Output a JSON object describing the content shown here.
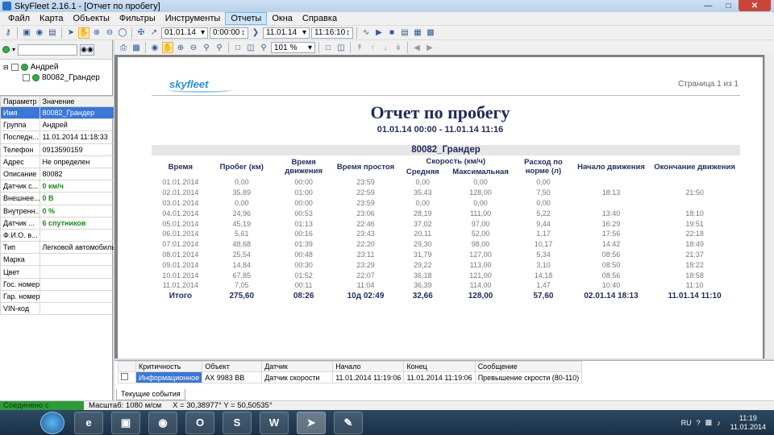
{
  "window": {
    "title": "SkyFleet 2.16.1 - [Отчет по пробегу]"
  },
  "menu": [
    "Файл",
    "Карта",
    "Объекты",
    "Фильтры",
    "Инструменты",
    "Отчеты",
    "Окна",
    "Справка"
  ],
  "toolbar": {
    "date_from": "01.01.14",
    "time_from": "0:00:00",
    "date_to": "11.01.14",
    "time_to": "11:16:10"
  },
  "tree": {
    "group": "Андрей",
    "vehicle": "80082_Грандер"
  },
  "props": {
    "headers": [
      "Параметр",
      "Значение"
    ],
    "rows": [
      [
        "Имя",
        "80082_Грандер"
      ],
      [
        "Группа",
        "Андрей"
      ],
      [
        "Последн...",
        "11.01.2014 11:18:33"
      ],
      [
        "Телефон",
        "0913590159"
      ],
      [
        "Адрес",
        "Не определен"
      ],
      [
        "Описание",
        "80082"
      ],
      [
        "Датчик с...",
        "0  км/ч"
      ],
      [
        "Внешнее...",
        "0  В"
      ],
      [
        "Внутренн...",
        "0  %"
      ],
      [
        "Датчик ...",
        "6 спутников"
      ],
      [
        "Ф.И.О. в...",
        ""
      ],
      [
        "Тип",
        "Легковой автомобиль"
      ],
      [
        "Марка",
        ""
      ],
      [
        "Цвет",
        ""
      ],
      [
        "Гос. номер",
        ""
      ],
      [
        "Гар. номер",
        ""
      ],
      [
        "VIN-код",
        ""
      ]
    ]
  },
  "viewer": {
    "zoom": "101 %"
  },
  "report": {
    "logo": "skyfleet",
    "page_info": "Страница 1 из 1",
    "title": "Отчет по пробегу",
    "period": "01.01.14 00:00 - 11.01.14 11:16",
    "vehicle": "80082_Грандер",
    "headers": {
      "time": "Время",
      "mileage": "Пробег (км)",
      "moving": "Время движения",
      "idle": "Время простоя",
      "speed": "Скорость (км/ч)",
      "avg": "Средняя",
      "max": "Максимальная",
      "fuel": "Расход по норме (л)",
      "start": "Начало движения",
      "end": "Окончание движения"
    },
    "rows": [
      [
        "01.01.2014",
        "0,00",
        "00:00",
        "23:59",
        "0,00",
        "0,00",
        "0,00",
        "",
        ""
      ],
      [
        "02.01.2014",
        "35,89",
        "01:00",
        "22:59",
        "35,43",
        "128,00",
        "7,50",
        "18:13",
        "21:50"
      ],
      [
        "03.01.2014",
        "0,00",
        "00:00",
        "23:59",
        "0,00",
        "0,00",
        "0,00",
        "",
        ""
      ],
      [
        "04.01.2014",
        "24,96",
        "00:53",
        "23:06",
        "28,19",
        "111,00",
        "5,22",
        "13:40",
        "18:10"
      ],
      [
        "05.01.2014",
        "45,19",
        "01:13",
        "22:46",
        "37,02",
        "97,00",
        "9,44",
        "16:29",
        "19:51"
      ],
      [
        "06.01.2014",
        "5,61",
        "00:16",
        "23:43",
        "20,11",
        "52,00",
        "1,17",
        "17:56",
        "22:18"
      ],
      [
        "07.01.2014",
        "48,68",
        "01:39",
        "22:20",
        "29,30",
        "98,00",
        "10,17",
        "14:42",
        "18:49"
      ],
      [
        "08.01.2014",
        "25,54",
        "00:48",
        "23:11",
        "31,79",
        "127,00",
        "5,34",
        "08:56",
        "21:37"
      ],
      [
        "09.01.2014",
        "14,84",
        "00:30",
        "23:29",
        "29,22",
        "113,00",
        "3,10",
        "08:50",
        "18:22"
      ],
      [
        "10.01.2014",
        "67,85",
        "01:52",
        "22:07",
        "36,18",
        "121,00",
        "14,18",
        "08:56",
        "18:58"
      ],
      [
        "11.01.2014",
        "7,05",
        "00:11",
        "11:04",
        "36,39",
        "114,00",
        "1,47",
        "10:40",
        "11:10"
      ]
    ],
    "total": [
      "Итого",
      "275,60",
      "08:26",
      "10д 02:49",
      "32,66",
      "128,00",
      "57,60",
      "02.01.14 18:13",
      "11.01.14 11:10"
    ]
  },
  "events": {
    "headers": [
      "",
      "Критичность",
      "Объект",
      "Датчик",
      "Начало",
      "Конец",
      "Сообщение"
    ],
    "rows": [
      [
        "",
        "Информационное",
        "АХ 9983 ВВ",
        "Датчик скорости",
        "11.01.2014 11:19:06",
        "11.01.2014 11:19:06",
        "Превышение скрости (80-110)"
      ]
    ],
    "tab": "Текущие события"
  },
  "status": {
    "connection": "Соединено с сервером",
    "scale": "Масштаб: 1080 м/см",
    "coords": "X = 30,38977° Y = 50,50535°"
  },
  "taskbar": {
    "lang": "RU",
    "time": "11:19",
    "date": "11.01.2014"
  },
  "colors": {
    "accent": "#3b77d6",
    "report_text": "#1f2a5c",
    "connected": "#2f9a3a"
  }
}
